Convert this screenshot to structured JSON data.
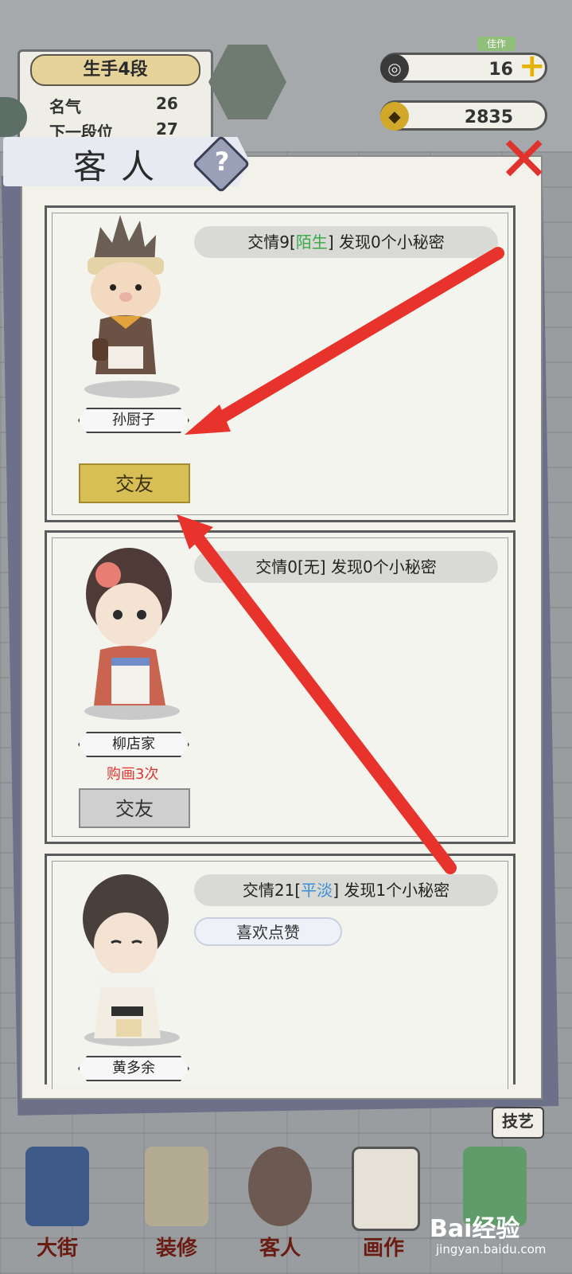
{
  "hud": {
    "rank": "生手4段",
    "fame_label": "名气",
    "fame_value": "26",
    "next_label": "下一段位",
    "next_value": "27",
    "tag": "佳作",
    "resource1_value": "16",
    "resource2_value": "2835",
    "resource2_icon": "coin-icon",
    "resource1_icon": "ink-swirl-icon"
  },
  "modal": {
    "title": "客人",
    "help": "?",
    "close": "✕"
  },
  "guests": [
    {
      "info_prefix": "交情9[",
      "status": "陌生",
      "info_suffix": "] 发现0个小秘密",
      "name": "孙厨子",
      "button": "交友"
    },
    {
      "info": "交情0[无] 发现0个小秘密",
      "name": "柳店家",
      "note": "购画3次",
      "button": "交友"
    },
    {
      "info_prefix": "交情21[",
      "status": "平淡",
      "info_suffix": "] 发现1个小秘密",
      "like": "喜欢点赞",
      "name": "黄多余"
    }
  ],
  "nav": {
    "street": "大街",
    "decorate": "装修",
    "guests": "客人",
    "paint": "画作",
    "skill": "技艺"
  },
  "watermark": {
    "brand": "Bai经验",
    "url": "jingyan.baidu.com"
  },
  "colors": {
    "arrow": "#e8332c",
    "friend_button_active": "#d7bf55",
    "friend_button_inactive": "#cfcfcf",
    "status_green": "#3aa94a",
    "status_blue": "#3b8fd6"
  }
}
